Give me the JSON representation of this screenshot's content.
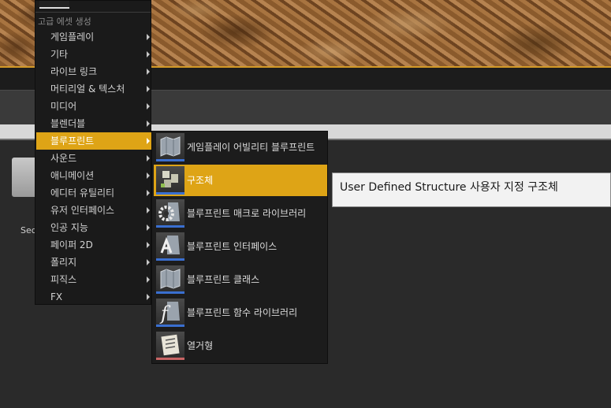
{
  "background": {
    "folder_label": "Sequ"
  },
  "main_menu": {
    "header": "고급 에셋 생성",
    "items": [
      {
        "label": "게임플레이",
        "icon": "submenu-arrow"
      },
      {
        "label": "기타",
        "icon": "submenu-arrow"
      },
      {
        "label": "라이브 링크",
        "icon": "submenu-arrow"
      },
      {
        "label": "머티리얼 & 텍스처",
        "icon": "submenu-arrow"
      },
      {
        "label": "미디어",
        "icon": "submenu-arrow"
      },
      {
        "label": "블렌더블",
        "icon": "submenu-arrow"
      },
      {
        "label": "블루프린트",
        "icon": "submenu-arrow",
        "state": "highlighted"
      },
      {
        "label": "사운드",
        "icon": "submenu-arrow"
      },
      {
        "label": "애니메이션",
        "icon": "submenu-arrow"
      },
      {
        "label": "에디터 유틸리티",
        "icon": "submenu-arrow"
      },
      {
        "label": "유저 인터페이스",
        "icon": "submenu-arrow"
      },
      {
        "label": "인공 지능",
        "icon": "submenu-arrow"
      },
      {
        "label": "페이퍼 2D",
        "icon": "submenu-arrow"
      },
      {
        "label": "폴리지",
        "icon": "submenu-arrow"
      },
      {
        "label": "피직스",
        "icon": "submenu-arrow"
      },
      {
        "label": "FX",
        "icon": "submenu-arrow"
      }
    ]
  },
  "submenu": {
    "items": [
      {
        "label": "게임플레이 어빌리티 블루프린트",
        "icon": "blueprint-map-icon"
      },
      {
        "label": "구조체",
        "icon": "structure-icon",
        "state": "highlighted"
      },
      {
        "label": "블루프린트 매크로 라이브러리",
        "icon": "macro-gear-icon"
      },
      {
        "label": "블루프린트 인터페이스",
        "icon": "interface-icon"
      },
      {
        "label": "블루프린트 클래스",
        "icon": "blueprint-map-icon"
      },
      {
        "label": "블루프린트 함수 라이브러리",
        "icon": "function-library-icon"
      },
      {
        "label": "열거형",
        "icon": "enum-list-icon"
      }
    ]
  },
  "tooltip": {
    "text": "User Defined Structure 사용자 지정 구조체"
  },
  "colors": {
    "highlight": "#dea416",
    "menu_bg": "#1a1a1a",
    "icon_underline_blueprint": "#3a6fd0",
    "icon_underline_enum": "#c86464"
  }
}
